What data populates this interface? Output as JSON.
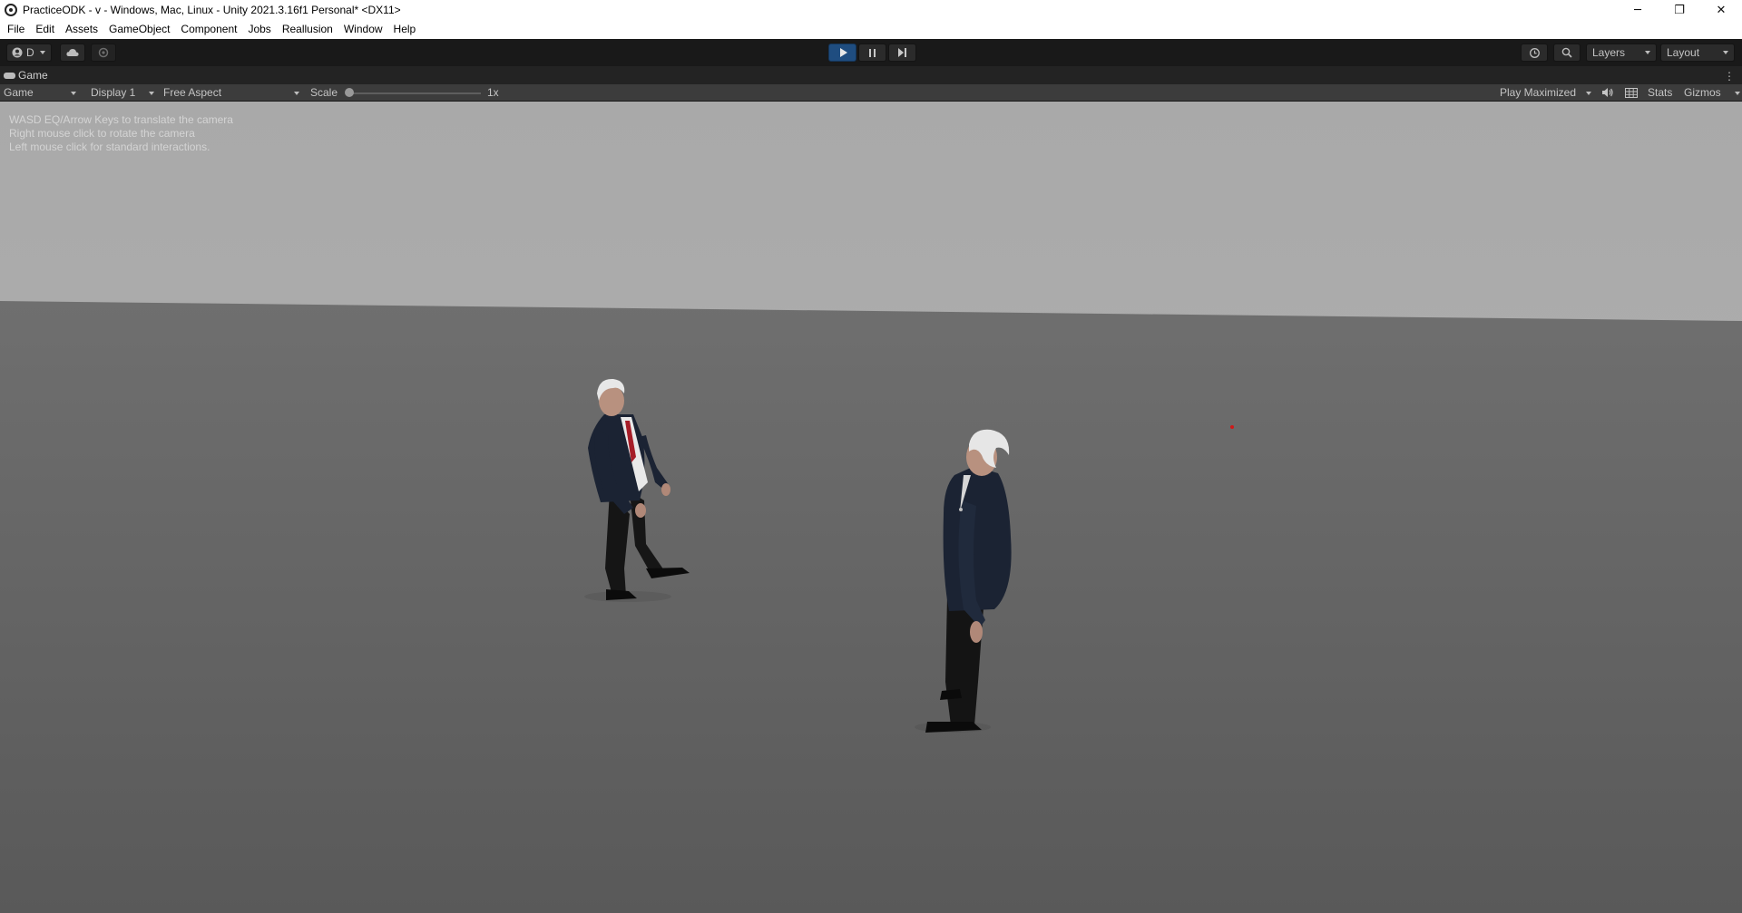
{
  "window": {
    "title": "PracticeODK - v - Windows, Mac, Linux - Unity 2021.3.16f1 Personal* <DX11>",
    "minimize_glyph": "─",
    "restore_glyph": "❐",
    "close_glyph": "✕"
  },
  "menu": [
    "File",
    "Edit",
    "Assets",
    "GameObject",
    "Component",
    "Jobs",
    "Reallusion",
    "Window",
    "Help"
  ],
  "toolbar": {
    "account_label": "D",
    "play_state": "playing",
    "layers_label": "Layers",
    "layout_label": "Layout",
    "accent_color": "#1f4d80"
  },
  "tab": {
    "label": "Game"
  },
  "gamebar": {
    "mode": "Game",
    "display": "Display 1",
    "aspect": "Free Aspect",
    "scale_label": "Scale",
    "scale_value": "1x",
    "play_mode": "Play Maximized",
    "stats_label": "Stats",
    "gizmos_label": "Gizmos"
  },
  "viewport": {
    "help_lines": [
      "WASD EQ/Arrow Keys to translate the camera",
      "Right mouse click to rotate the camera",
      "Left mouse click for standard interactions."
    ],
    "sky_color": "#acacac",
    "ground_color": "#6a6a6a"
  }
}
